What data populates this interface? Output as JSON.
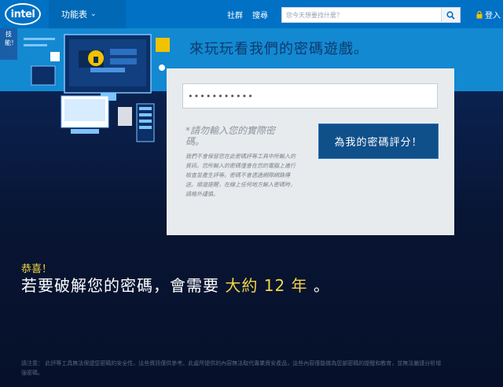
{
  "header": {
    "logo_text": "intel",
    "menu_label": "功能表",
    "links": [
      "社群",
      "搜尋"
    ],
    "search_placeholder": "您今天想要找什麼？",
    "login_label": "登入"
  },
  "side_tab": {
    "label": "技能！"
  },
  "hero": {
    "title": "來玩玩看我們的密碼遊戲。"
  },
  "card": {
    "password_value": "•••••••••••",
    "warning_title": "*請勿輸入您的實際密碼。",
    "warning_body": "我們不會保留您在此密碼評等工具中所輸入的資訊。您所輸入的密碼僅會在您的電腦上進行檢查並產生評等。密碼不會透過網際網路傳送。順道提醒，在線上任何地方輸入密碼時，請格外謹慎。",
    "rate_button": "為我的密碼評分！"
  },
  "result": {
    "congrats": "恭喜！",
    "prefix": "若要破解您的密碼，會需要",
    "highlight": "大約 12 年",
    "suffix": "。"
  },
  "disclaimer": "請注意： 此評等工具無法保證您密碼的安全性，這些資訊僅供參考。此處所提供的內容無法取代專業資安產品，這些內容僅能做為您部密碼的提醒和教育，並無法嚴謹分析增強密碼。",
  "colors": {
    "nav": "#0071c5",
    "hero": "#1389d1",
    "accent": "#f2d544",
    "button": "#0f4f8a"
  }
}
